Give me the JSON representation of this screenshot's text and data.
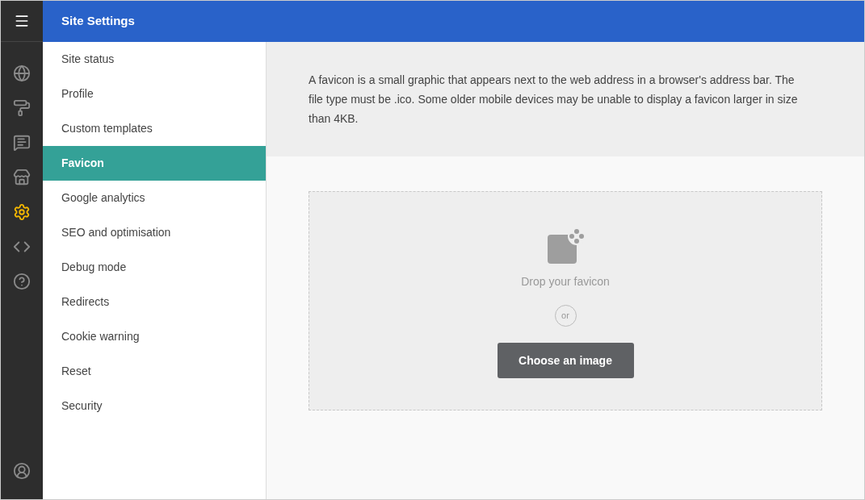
{
  "header": {
    "title": "Site Settings"
  },
  "rail": [
    {
      "selected": false
    },
    {
      "selected": false
    },
    {
      "selected": false
    },
    {
      "selected": false
    },
    {
      "selected": true
    },
    {
      "selected": false
    },
    {
      "selected": false
    }
  ],
  "menu": [
    {
      "label": "Site status",
      "selected": false
    },
    {
      "label": "Profile",
      "selected": false
    },
    {
      "label": "Custom templates",
      "selected": false
    },
    {
      "label": "Favicon",
      "selected": true
    },
    {
      "label": "Google analytics",
      "selected": false
    },
    {
      "label": "SEO and optimisation",
      "selected": false
    },
    {
      "label": "Debug mode",
      "selected": false
    },
    {
      "label": "Redirects",
      "selected": false
    },
    {
      "label": "Cookie warning",
      "selected": false
    },
    {
      "label": "Reset",
      "selected": false
    },
    {
      "label": "Security",
      "selected": false
    }
  ],
  "description": "A favicon is a small graphic that appears next to the web address in a browser's address bar. The file type must be .ico. Some older mobile devices may be unable to display a favicon larger in size than 4KB.",
  "dropzone": {
    "prompt": "Drop your favicon",
    "separator": "or",
    "button": "Choose an image"
  }
}
